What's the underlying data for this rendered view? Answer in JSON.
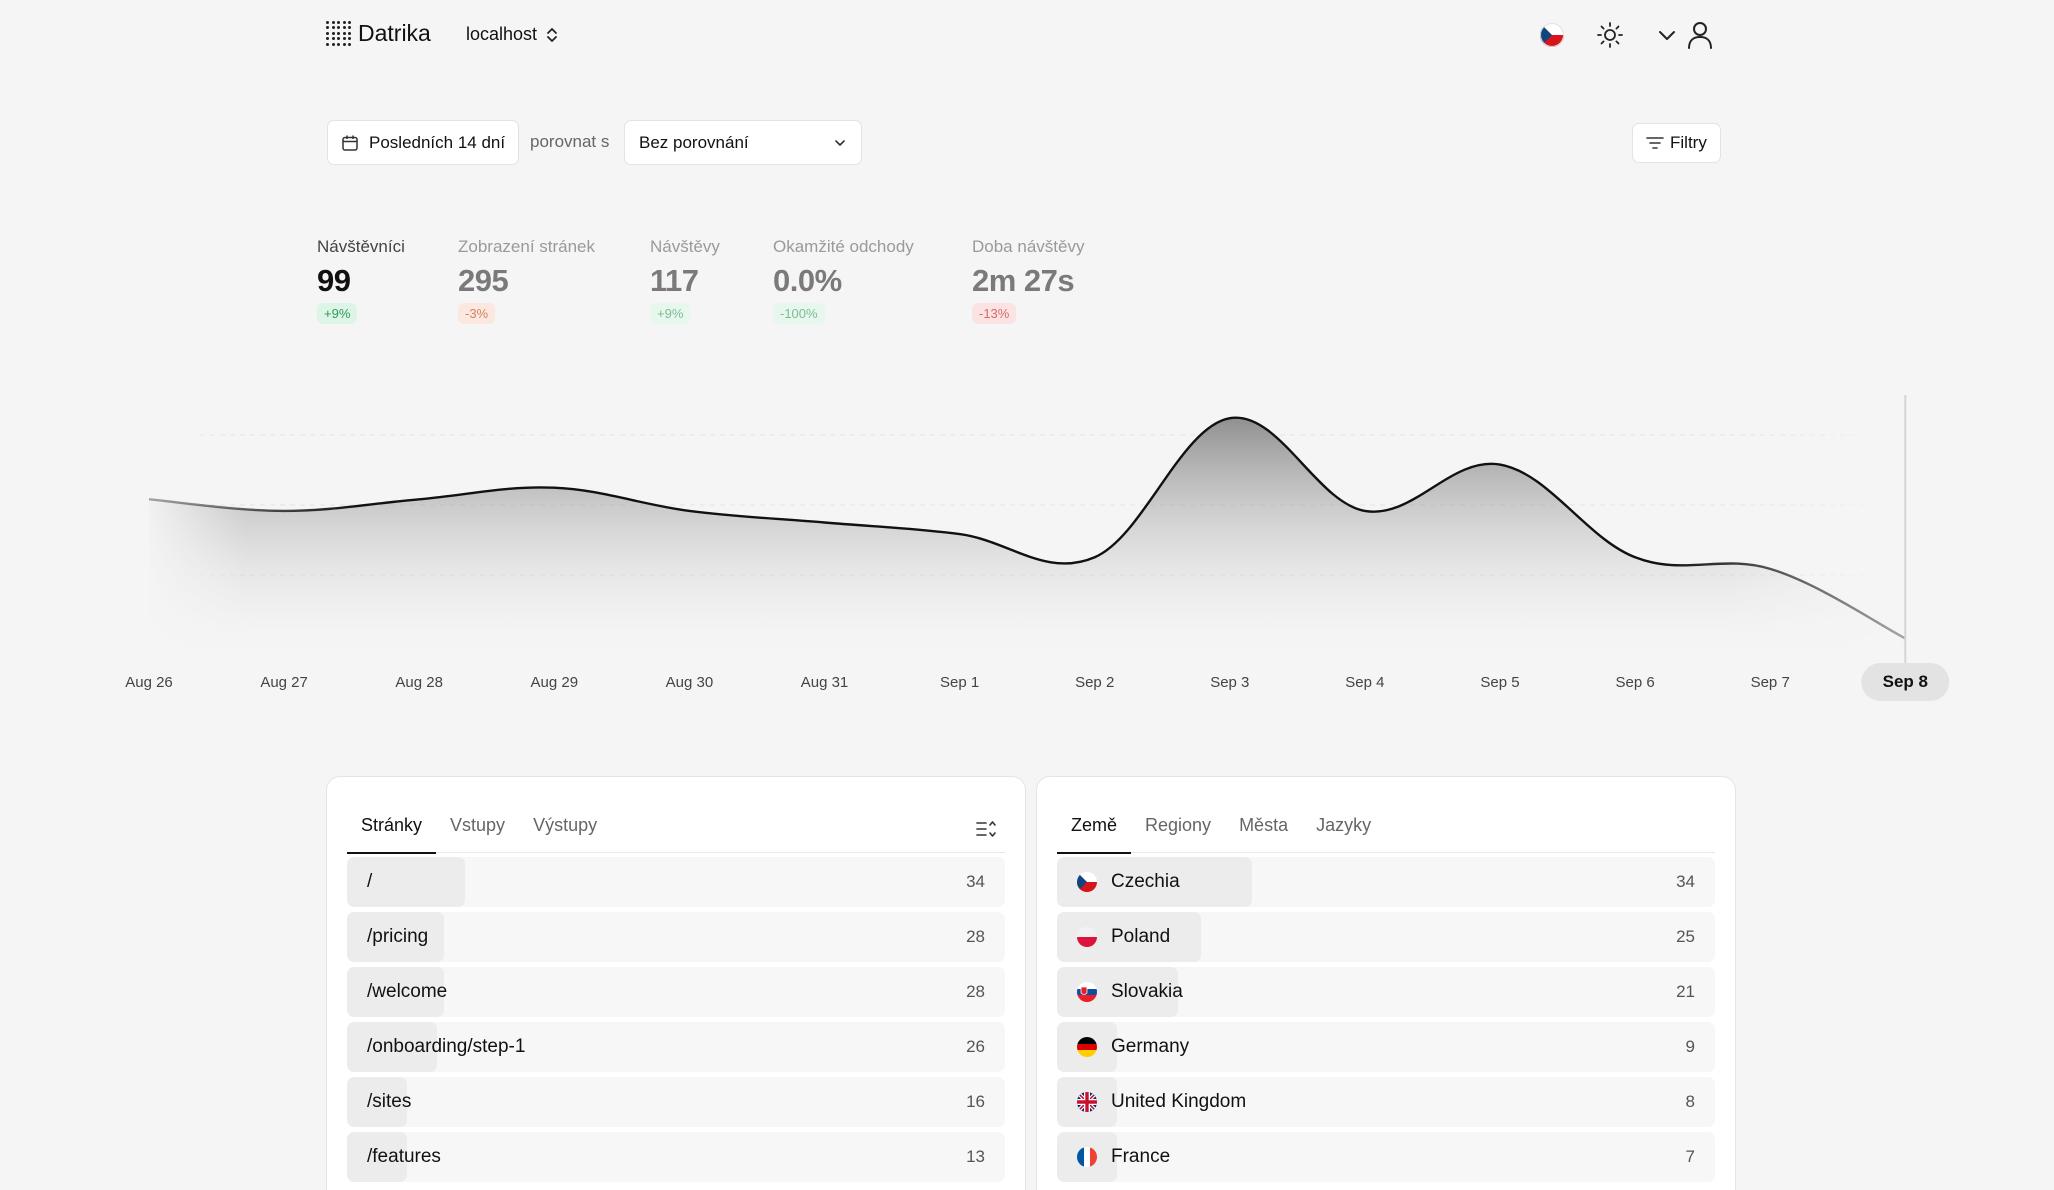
{
  "header": {
    "app_name": "Datrika",
    "site": "localhost"
  },
  "controls": {
    "date_range": "Posledních 14 dní",
    "compare_label": "porovnat s",
    "compare_value": "Bez porovnání",
    "filters_label": "Filtry"
  },
  "metrics": [
    {
      "label": "Návštěvníci",
      "value": "99",
      "change": "+9%"
    },
    {
      "label": "Zobrazení stránek",
      "value": "295",
      "change": "-3%"
    },
    {
      "label": "Návštěvy",
      "value": "117",
      "change": "+9%"
    },
    {
      "label": "Okamžité odchody",
      "value": "0.0%",
      "change": "-100%"
    },
    {
      "label": "Doba návštěvy",
      "value": "2m 27s",
      "change": "-13%"
    }
  ],
  "chart_data": {
    "type": "area",
    "x": [
      "Aug 26",
      "Aug 27",
      "Aug 28",
      "Aug 29",
      "Aug 30",
      "Aug 31",
      "Sep 1",
      "Sep 2",
      "Sep 3",
      "Sep 4",
      "Sep 5",
      "Sep 6",
      "Sep 7",
      "Sep 8"
    ],
    "series": [
      {
        "values": [
          6,
          5,
          6,
          7,
          5,
          4,
          3,
          1,
          13,
          5,
          9,
          1,
          0,
          -6
        ]
      }
    ],
    "ylim": [
      -7,
      15
    ],
    "grid": true,
    "highlighted_x": "Sep 8"
  },
  "pages_panel": {
    "tabs": [
      "Stránky",
      "Vstupy",
      "Výstupy"
    ],
    "rows": [
      {
        "label": "/",
        "value": "34",
        "fraction": 1.0
      },
      {
        "label": "/pricing",
        "value": "28",
        "fraction": 0.82
      },
      {
        "label": "/welcome",
        "value": "28",
        "fraction": 0.82
      },
      {
        "label": "/onboarding/step-1",
        "value": "26",
        "fraction": 0.76
      },
      {
        "label": "/sites",
        "value": "16",
        "fraction": 0.47
      },
      {
        "label": "/features",
        "value": "13",
        "fraction": 0.38
      }
    ]
  },
  "countries_panel": {
    "tabs": [
      "Země",
      "Regiony",
      "Města",
      "Jazyky"
    ],
    "rows": [
      {
        "label": "Czechia",
        "value": "34",
        "fraction": 1.0,
        "flag": "cz"
      },
      {
        "label": "Poland",
        "value": "25",
        "fraction": 0.74,
        "flag": "pl"
      },
      {
        "label": "Slovakia",
        "value": "21",
        "fraction": 0.62,
        "flag": "sk"
      },
      {
        "label": "Germany",
        "value": "9",
        "fraction": 0.26,
        "flag": "de"
      },
      {
        "label": "United Kingdom",
        "value": "8",
        "fraction": 0.24,
        "flag": "gb"
      },
      {
        "label": "France",
        "value": "7",
        "fraction": 0.21,
        "flag": "fr"
      }
    ]
  }
}
